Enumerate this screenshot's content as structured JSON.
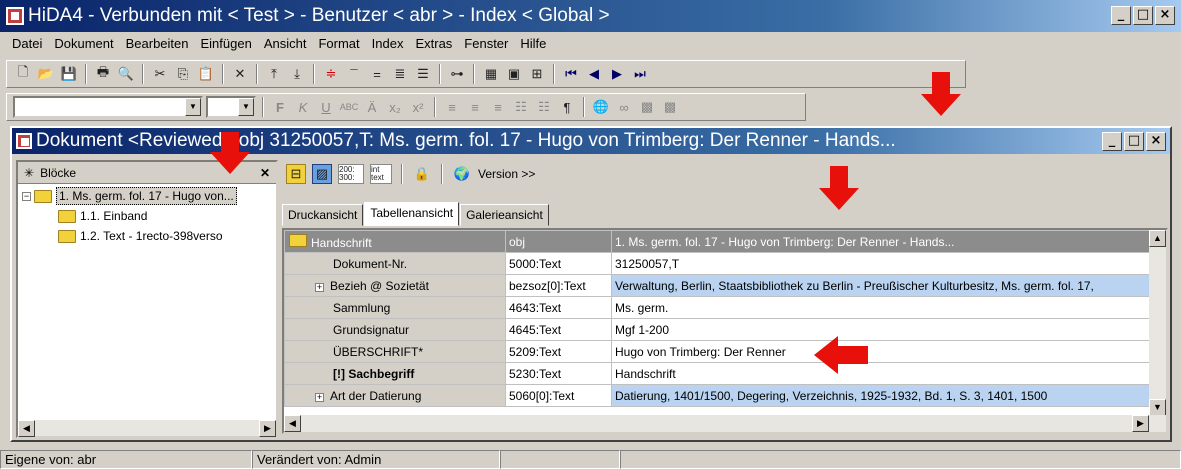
{
  "app": {
    "title": "HiDA4 - Verbunden mit < Test > - Benutzer < abr > - Index < Global >"
  },
  "menu": [
    "Datei",
    "Dokument",
    "Bearbeiten",
    "Einfügen",
    "Ansicht",
    "Format",
    "Index",
    "Extras",
    "Fenster",
    "Hilfe"
  ],
  "document": {
    "title": "Dokument <Reviewed> obj 31250057,T: Ms. germ. fol. 17 - Hugo von Trimberg: Der Renner - Hands..."
  },
  "left_panel": {
    "header": "Blöcke",
    "tree": [
      {
        "label": "1. Ms. germ. fol. 17 - Hugo von..."
      },
      {
        "label": "1.1. Einband"
      },
      {
        "label": "1.2. Text - 1recto-398verso"
      }
    ]
  },
  "toolbar2": {
    "version_label": "Version >>",
    "badge1": "200: 300:",
    "badge2": "int text"
  },
  "tabs": [
    "Druckansicht",
    "Tabellenansicht",
    "Galerieansicht"
  ],
  "table": {
    "header": [
      "Handschrift",
      "obj",
      "1. Ms. germ. fol. 17 - Hugo von Trimberg: Der Renner - Hands..."
    ],
    "rows": [
      {
        "label": "Dokument-Nr.",
        "code": "5000:Text",
        "value": "31250057,T"
      },
      {
        "label": "Bezieh @ Sozietät",
        "code": "bezsoz[0]:Text",
        "value": "Verwaltung, Berlin, Staatsbibliothek zu Berlin - Preußischer Kulturbesitz, Ms. germ. fol. 17,"
      },
      {
        "label": "Sammlung",
        "code": "4643:Text",
        "value": "Ms. germ."
      },
      {
        "label": "Grundsignatur",
        "code": "4645:Text",
        "value": "Mgf 1-200"
      },
      {
        "label": "ÜBERSCHRIFT*",
        "code": "5209:Text",
        "value": "Hugo von Trimberg: Der Renner"
      },
      {
        "label": "[!] Sachbegriff",
        "code": "5230:Text",
        "value": "Handschrift"
      },
      {
        "label": "Art der Datierung",
        "code": "5060[0]:Text",
        "value": "Datierung, 1401/1500, Degering, Verzeichnis, 1925-1932, Bd. 1, S. 3, 1401, 1500"
      }
    ]
  },
  "status": {
    "owner": "Eigene von: abr",
    "changed": "Verändert von: Admin"
  },
  "colors": {
    "title_start": "#0a246a",
    "highlight": "#b9d3f0",
    "arrow": "#e8100a"
  }
}
